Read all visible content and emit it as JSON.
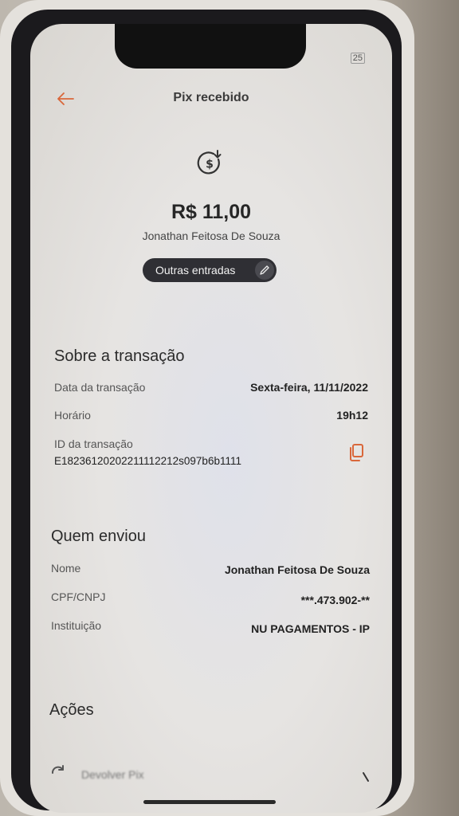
{
  "status_bar": {
    "battery": "25"
  },
  "header": {
    "title": "Pix recebido"
  },
  "summary": {
    "amount": "R$ 11,00",
    "sender": "Jonathan Feitosa De Souza",
    "category_chip": "Outras entradas"
  },
  "transaction": {
    "section_title": "Sobre a transação",
    "date_label": "Data da transação",
    "date_value": "Sexta-feira, 11/11/2022",
    "time_label": "Horário",
    "time_value": "19h12",
    "id_label": "ID da transação",
    "id_value": "E18236120202211112212s097b6b1111"
  },
  "sender_info": {
    "section_title": "Quem enviou",
    "name_label": "Nome",
    "name_value": "Jonathan Feitosa De Souza",
    "doc_label": "CPF/CNPJ",
    "doc_value": "***.473.902-**",
    "institution_label": "Instituição",
    "institution_value": "NU PAGAMENTOS - IP"
  },
  "actions": {
    "section_title": "Ações",
    "items": [
      {
        "label": "Devolver Pix"
      }
    ]
  },
  "colors": {
    "accent": "#d9673a",
    "chip_bg": "#2f2f34"
  },
  "icons": {
    "back": "arrow-left-icon",
    "pix": "dollar-arrow-down-icon",
    "edit": "pencil-icon",
    "copy": "copy-icon",
    "refund": "refresh-icon",
    "chevron": "chevron-right-icon"
  }
}
